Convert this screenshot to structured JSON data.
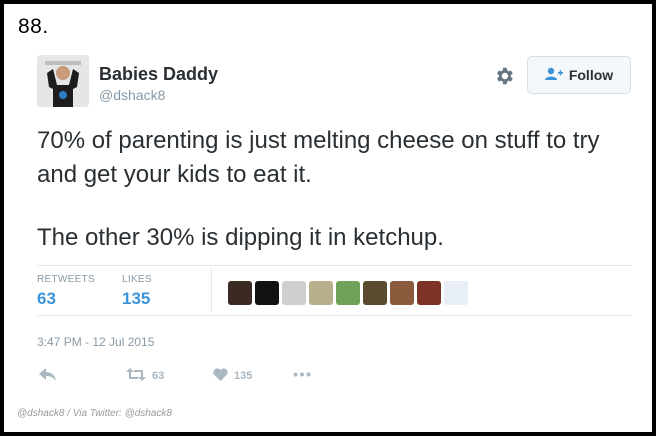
{
  "list_number": "88.",
  "author": {
    "display_name": "Babies Daddy",
    "handle": "@dshack8"
  },
  "follow_button": {
    "label": "Follow"
  },
  "tweet": {
    "paragraphs": [
      "70% of parenting is just melting cheese on stuff to try and get your kids to eat it.",
      "The other 30% is dipping it in ketchup."
    ]
  },
  "stats": {
    "retweets_label": "RETWEETS",
    "retweets_value": "63",
    "likes_label": "LIKES",
    "likes_value": "135"
  },
  "likers": [
    {
      "icon": "avatar-1",
      "color": "#3a2a22"
    },
    {
      "icon": "avatar-2",
      "color": "#111111"
    },
    {
      "icon": "avatar-3",
      "color": "#cfcfcf"
    },
    {
      "icon": "avatar-4",
      "color": "#b7b08a"
    },
    {
      "icon": "avatar-5",
      "color": "#6fa35a"
    },
    {
      "icon": "avatar-6",
      "color": "#5a4a2e"
    },
    {
      "icon": "avatar-7",
      "color": "#8c5a3c"
    },
    {
      "icon": "avatar-8",
      "color": "#7a3326"
    },
    {
      "icon": "avatar-9",
      "color": "#e8eef5"
    }
  ],
  "timestamp": "3:47 PM - 12 Jul 2015",
  "actions": {
    "retweet_count": "63",
    "like_count": "135"
  },
  "credit": "@dshack8 / Via Twitter: @dshack8",
  "colors": {
    "link_blue": "#3b94d9",
    "text_dark": "#292f33",
    "text_muted": "#8899a6"
  }
}
